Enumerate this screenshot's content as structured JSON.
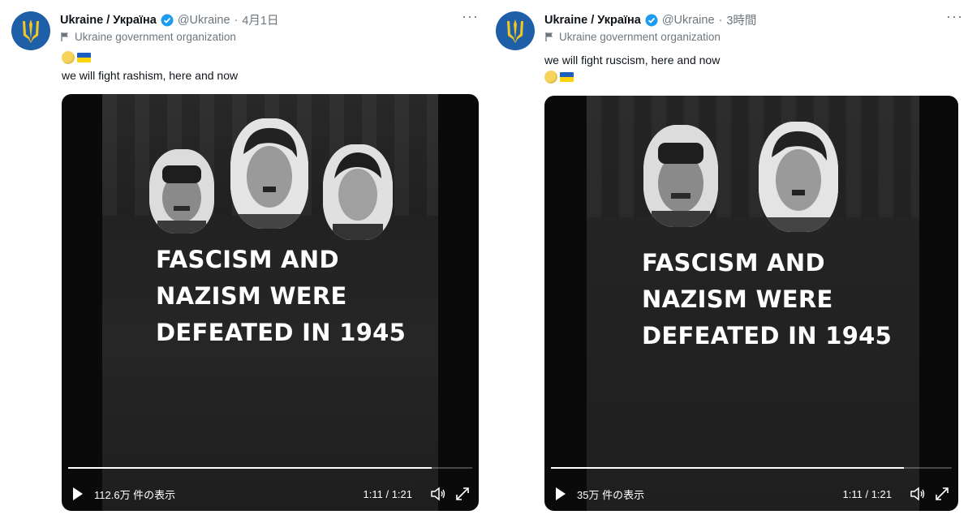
{
  "tweets": [
    {
      "name": "Ukraine / Україна",
      "handle": "@Ukraine",
      "time_sep": "·",
      "time": "4月1日",
      "org_label": "Ukraine government organization",
      "text": "we will fight rashism, here and now",
      "video": {
        "lines": [
          "FASCISM AND",
          "NAZISM WERE",
          "DEFEATED IN 1945"
        ],
        "views": "112.6万 件の表示",
        "duration": "1:11 / 1:21",
        "progress_fraction": 0.9
      }
    },
    {
      "name": "Ukraine / Україна",
      "handle": "@Ukraine",
      "time_sep": "·",
      "time": "3時間",
      "org_label": "Ukraine government organization",
      "text": "we will fight ruscism, here and now",
      "video": {
        "lines": [
          "FASCISM AND",
          "NAZISM WERE",
          "DEFEATED IN 1945"
        ],
        "views": "35万 件の表示",
        "duration": "1:11 / 1:21",
        "progress_fraction": 0.88
      }
    }
  ],
  "icons": {
    "avatar": "trident-icon",
    "verified": "verified-badge-icon",
    "org": "flag-icon",
    "more": "more-options-icon",
    "play": "play-icon",
    "volume": "volume-icon",
    "fullscreen": "fullscreen-icon"
  },
  "colors": {
    "avatar_bg": "#1f5fa8",
    "verified": "#1d9bf0",
    "muted_text": "#6e767d",
    "video_bg": "#0a0a0a"
  }
}
